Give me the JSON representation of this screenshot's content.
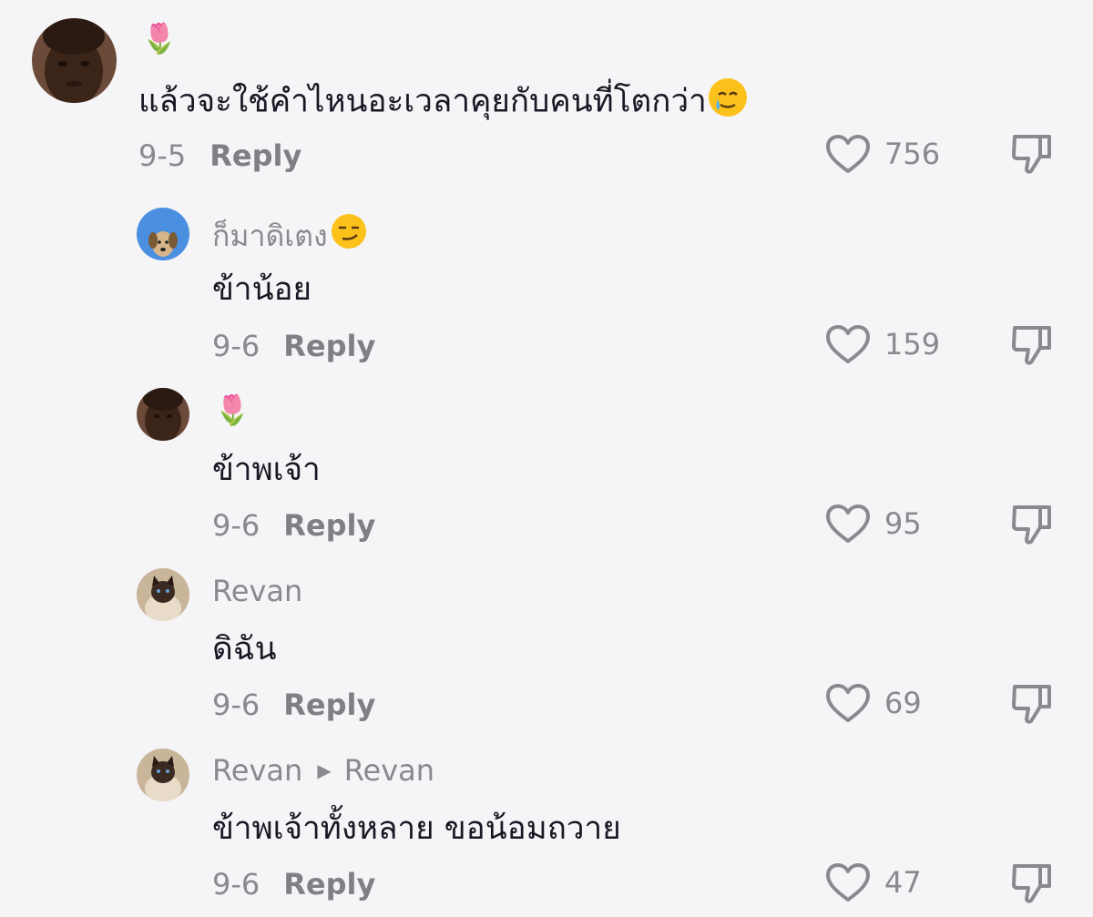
{
  "comments": [
    {
      "username": "🌷",
      "text": "แล้วจะใช้คำไหนอะเวลาคุยกับคนที่โตกว่า",
      "text_emoji": "crying-smile-emoji",
      "date": "9-5",
      "reply_label": "Reply",
      "likes": "756"
    },
    {
      "username": "ก็มาดิเตง",
      "username_emoji": "smirk-emoji",
      "text": "ข้าน้อย",
      "date": "9-6",
      "reply_label": "Reply",
      "likes": "159"
    },
    {
      "username": "🌷",
      "text": "ข้าพเจ้า",
      "date": "9-6",
      "reply_label": "Reply",
      "likes": "95"
    },
    {
      "username": "Revan",
      "text": "ดิฉัน",
      "date": "9-6",
      "reply_label": "Reply",
      "likes": "69"
    },
    {
      "username": "Revan",
      "reply_to": "Revan",
      "text": "ข้าพเจ้าทั้งหลาย ขอน้อมถวาย",
      "date": "9-6",
      "reply_label": "Reply",
      "likes": "47"
    }
  ]
}
